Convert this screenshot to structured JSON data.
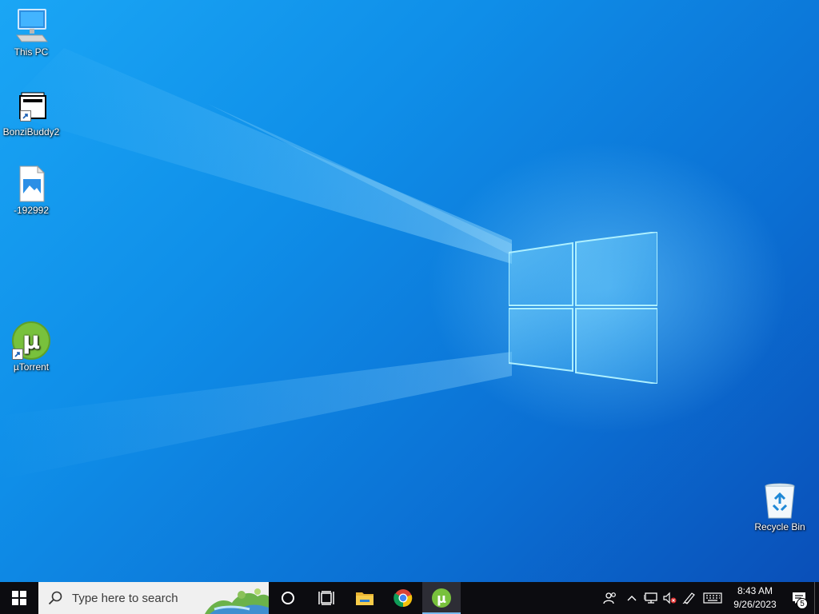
{
  "desktop": {
    "icons": [
      {
        "label": "This PC",
        "icon": "computer-icon"
      },
      {
        "label": "BonziBuddy2",
        "icon": "folder-shortcut-icon"
      },
      {
        "label": "-192992",
        "icon": "image-file-icon"
      },
      {
        "label": "µTorrent",
        "icon": "utorrent-icon"
      },
      {
        "label": "Recycle Bin",
        "icon": "recycle-bin-icon"
      }
    ]
  },
  "taskbar": {
    "search_placeholder": "Type here to search",
    "pinned": [
      {
        "name": "cortana",
        "icon": "circle-icon"
      },
      {
        "name": "task-view",
        "icon": "task-view-icon"
      },
      {
        "name": "file-explorer",
        "icon": "folder-icon"
      },
      {
        "name": "chrome",
        "icon": "chrome-icon"
      },
      {
        "name": "utorrent",
        "icon": "utorrent-icon",
        "active": true
      }
    ],
    "tray": {
      "time": "8:43 AM",
      "date": "9/26/2023",
      "notification_count": "5"
    }
  },
  "colors": {
    "taskbar_bg": "#0c0c10",
    "accent": "#76b9ed",
    "wallpaper_primary": "#0f8ee8"
  }
}
